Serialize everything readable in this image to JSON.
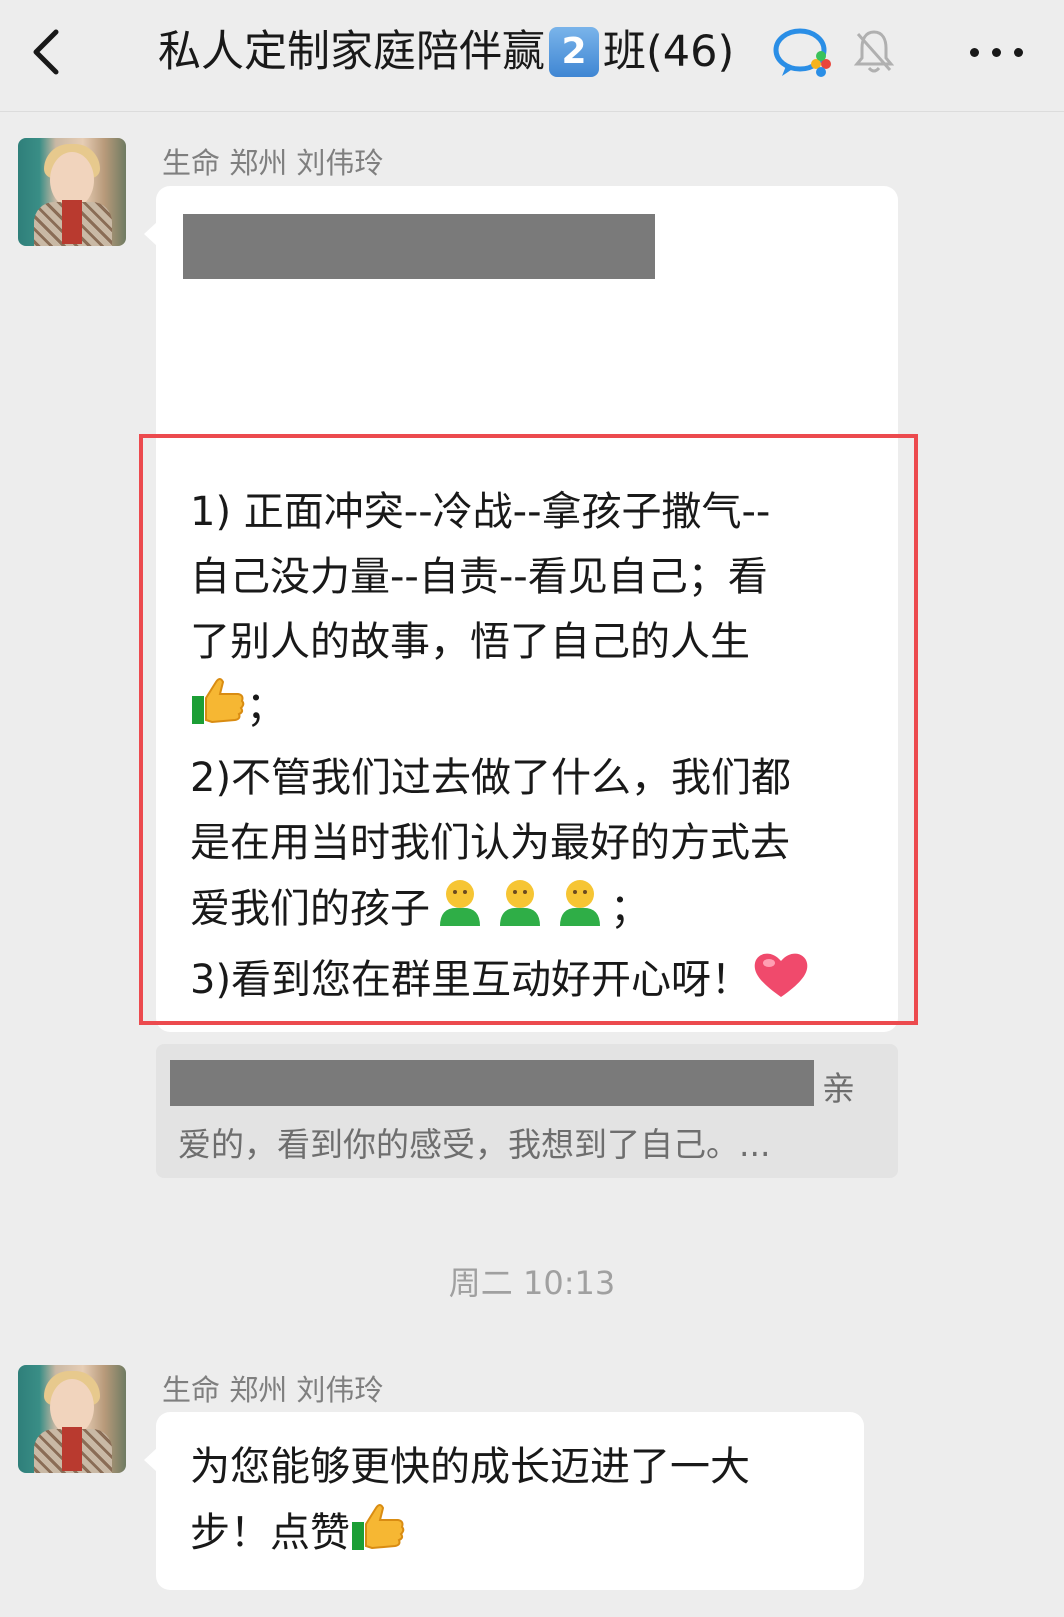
{
  "header": {
    "title_prefix": "私人定制家庭陪伴赢",
    "title_badge": "2",
    "title_suffix": "班(46)",
    "back_icon": "chevron-left-icon",
    "wecom_icon": "wecom-chat-icon",
    "mute_icon": "bell-muted-icon",
    "more_icon": "more-dots-icon"
  },
  "messages": [
    {
      "sender": "生命 郑州 刘伟玲",
      "lines": [
        "1) 正面冲突--冷战--拿孩子撒气--",
        "自己没力量--自责--看见自己；看",
        "了别人的故事，悟了自己的人生",
        "；",
        "2)不管我们过去做了什么，我们都",
        "是在用当时我们认为最好的方式去",
        "爱我们的孩子",
        "；",
        "3)看到您在群里互动好开心呀！"
      ],
      "quote": {
        "line1_end": "亲",
        "line2": "爱的，看到你的感受，我想到了自己。..."
      }
    },
    {
      "sender": "生命 郑州 刘伟玲",
      "lines": [
        "为您能够更快的成长迈进了一大",
        "步！点赞"
      ]
    }
  ],
  "timestamp": "周二 10:13",
  "colors": {
    "background": "#ededed",
    "bubble": "#ffffff",
    "highlight": "#ec4a4e",
    "redaction": "#7a7a7a"
  }
}
